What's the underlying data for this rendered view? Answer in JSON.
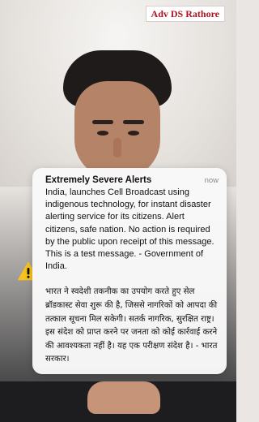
{
  "watermark": {
    "text": "Adv DS Rathore"
  },
  "alert": {
    "title": "Extremely Severe Alerts",
    "time": "now",
    "body_en": "India, launches Cell Broadcast using indigenous technology, for instant disaster alerting service for its citizens. Alert citizens, safe nation. No action is required by the public upon receipt of this message. This is a test message. - Government of India.",
    "body_hi": "भारत ने स्वदेशी तकनीक का उपयोग करते हुए सेल ब्रॉडकास्ट सेवा शुरू की है, जिससे नागरिकों को आपदा की तत्काल सूचना मिल सकेगी। सतर्क नागरिक, सुरक्षित राष्ट्र। इस संदेश को प्राप्त करने पर जनता को कोई कार्रवाई करने की आवश्यकता नहीं है। यह एक परीक्षण संदेश है। - भारत सरकार।",
    "icon": "warning-triangle-icon"
  },
  "colors": {
    "watermark_text": "#b1121f",
    "warning_yellow": "#f7c21b",
    "card_bg": "#f9f9fa"
  }
}
